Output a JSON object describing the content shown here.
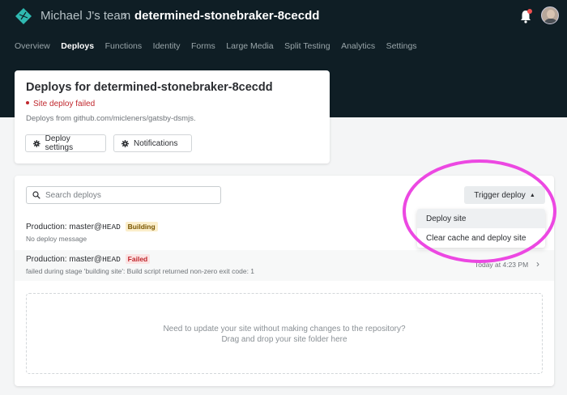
{
  "header": {
    "team": "Michael J's team",
    "separator": "›",
    "site_name": "determined-stonebraker-8cecdd"
  },
  "nav": {
    "items": [
      {
        "label": "Overview",
        "active": false
      },
      {
        "label": "Deploys",
        "active": true
      },
      {
        "label": "Functions",
        "active": false
      },
      {
        "label": "Identity",
        "active": false
      },
      {
        "label": "Forms",
        "active": false
      },
      {
        "label": "Large Media",
        "active": false
      },
      {
        "label": "Split Testing",
        "active": false
      },
      {
        "label": "Analytics",
        "active": false
      },
      {
        "label": "Settings",
        "active": false
      }
    ]
  },
  "site_card": {
    "title": "Deploys for determined-stonebraker-8cecdd",
    "status": "Site deploy failed",
    "source": "Deploys from github.com/micleners/gatsby-dsmjs.",
    "deploy_settings_label": "Deploy settings",
    "notifications_label": "Notifications"
  },
  "deploys": {
    "search_placeholder": "Search deploys",
    "trigger_label": "Trigger deploy",
    "trigger_menu": [
      "Deploy site",
      "Clear cache and deploy site"
    ],
    "rows": [
      {
        "prefix": "Production: master@",
        "ref": "HEAD",
        "badge": "Building",
        "message": "No deploy message",
        "time": ""
      },
      {
        "prefix": "Production: master@",
        "ref": "HEAD",
        "badge": "Failed",
        "message": "failed during stage 'building site': Build script returned non-zero exit code: 1",
        "time": "Today at 4:23 PM"
      }
    ],
    "dropzone_line1": "Need to update your site without making changes to the repository?",
    "dropzone_line2": "Drag and drop your site folder here"
  },
  "colors": {
    "header_bg": "#0f1e25",
    "error": "#c0272d",
    "building_badge_bg": "#fbeecb",
    "annotation": "#ec48e2"
  },
  "icons": [
    "netlify-logo-icon",
    "bell-icon",
    "gear-icon",
    "search-icon",
    "caret-up-icon",
    "chevron-right-icon"
  ]
}
